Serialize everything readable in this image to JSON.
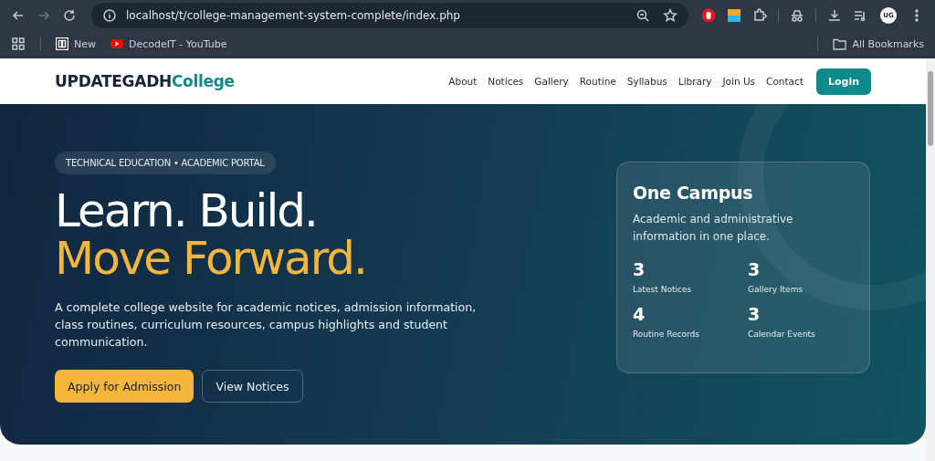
{
  "browser": {
    "url": "localhost/t/college-management-system-complete/index.php",
    "bookmarks": [
      {
        "label": "New",
        "kind": "site"
      },
      {
        "label": "DecodeIT - YouTube",
        "kind": "youtube"
      }
    ],
    "all_bookmarks": "All Bookmarks",
    "profile": "UG"
  },
  "navbar": {
    "brand": "UPDATEGADH",
    "brand_accent": "College",
    "links": [
      "About",
      "Notices",
      "Gallery",
      "Routine",
      "Syllabus",
      "Library",
      "Join Us",
      "Contact"
    ],
    "login": "Login"
  },
  "hero": {
    "badge": "TECHNICAL EDUCATION • ACADEMIC PORTAL",
    "headline": "Learn. Build.",
    "headline_accent": "Move Forward.",
    "description": "A complete college website for academic notices, admission information, class routines, curriculum resources, campus highlights and student communication.",
    "buttons": [
      {
        "label": "Apply for Admission",
        "kind": "primary"
      },
      {
        "label": "View Notices",
        "kind": "outline"
      }
    ]
  },
  "campus_card": {
    "title": "One Campus",
    "text": "Academic and administrative information in one place.",
    "stats": [
      {
        "value": "3",
        "label": "Latest Notices"
      },
      {
        "value": "3",
        "label": "Gallery Items"
      },
      {
        "value": "4",
        "label": "Routine Records"
      },
      {
        "value": "3",
        "label": "Calendar Events"
      }
    ]
  }
}
